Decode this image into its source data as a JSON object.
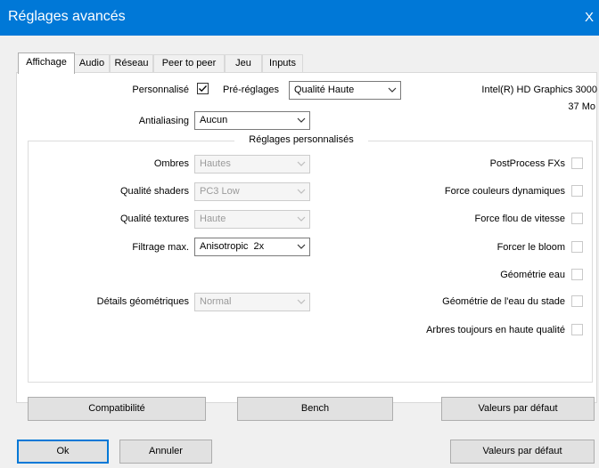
{
  "window": {
    "title": "Réglages avancés",
    "close_glyph": "X"
  },
  "tabs": [
    {
      "label": "Affichage",
      "active": true
    },
    {
      "label": "Audio"
    },
    {
      "label": "Réseau"
    },
    {
      "label": "Peer to peer"
    },
    {
      "label": "Jeu"
    },
    {
      "label": "Inputs"
    }
  ],
  "display": {
    "personalise_label": "Personnalisé",
    "personalise_checked": true,
    "presets_label": "Pré-réglages",
    "presets_value": "Qualité Haute",
    "antialiasing_label": "Antialiasing",
    "antialiasing_value": "Aucun",
    "gpu_name": "Intel(R) HD Graphics 3000",
    "gpu_memory": "37 Mo"
  },
  "custom": {
    "group_title": "Réglages personnalisés",
    "left": {
      "ombres": {
        "label": "Ombres",
        "value": "Hautes"
      },
      "shaders": {
        "label": "Qualité shaders",
        "value": "PC3 Low"
      },
      "textures": {
        "label": "Qualité textures",
        "value": "Haute"
      },
      "filtrage": {
        "label": "Filtrage max.",
        "value": "Anisotropic  2x"
      },
      "details": {
        "label": "Détails géométriques",
        "value": "Normal"
      }
    },
    "right": [
      {
        "label": "PostProcess FXs",
        "checked": false
      },
      {
        "label": "Force couleurs dynamiques",
        "checked": false
      },
      {
        "label": "Force flou de vitesse",
        "checked": false
      },
      {
        "label": "Forcer le bloom",
        "checked": false
      },
      {
        "label": "Géométrie eau",
        "checked": false
      },
      {
        "label": "Géométrie de l'eau du stade",
        "checked": false
      },
      {
        "label": "Arbres toujours en haute qualité",
        "checked": false
      }
    ]
  },
  "panel_buttons": {
    "compat": "Compatibilité",
    "bench": "Bench",
    "defaults": "Valeurs par défaut"
  },
  "footer": {
    "ok": "Ok",
    "cancel": "Annuler",
    "defaults": "Valeurs par défaut"
  },
  "colors": {
    "accent": "#0078d7",
    "window_bg": "#f0f0f0",
    "panel_bg": "#ffffff"
  }
}
